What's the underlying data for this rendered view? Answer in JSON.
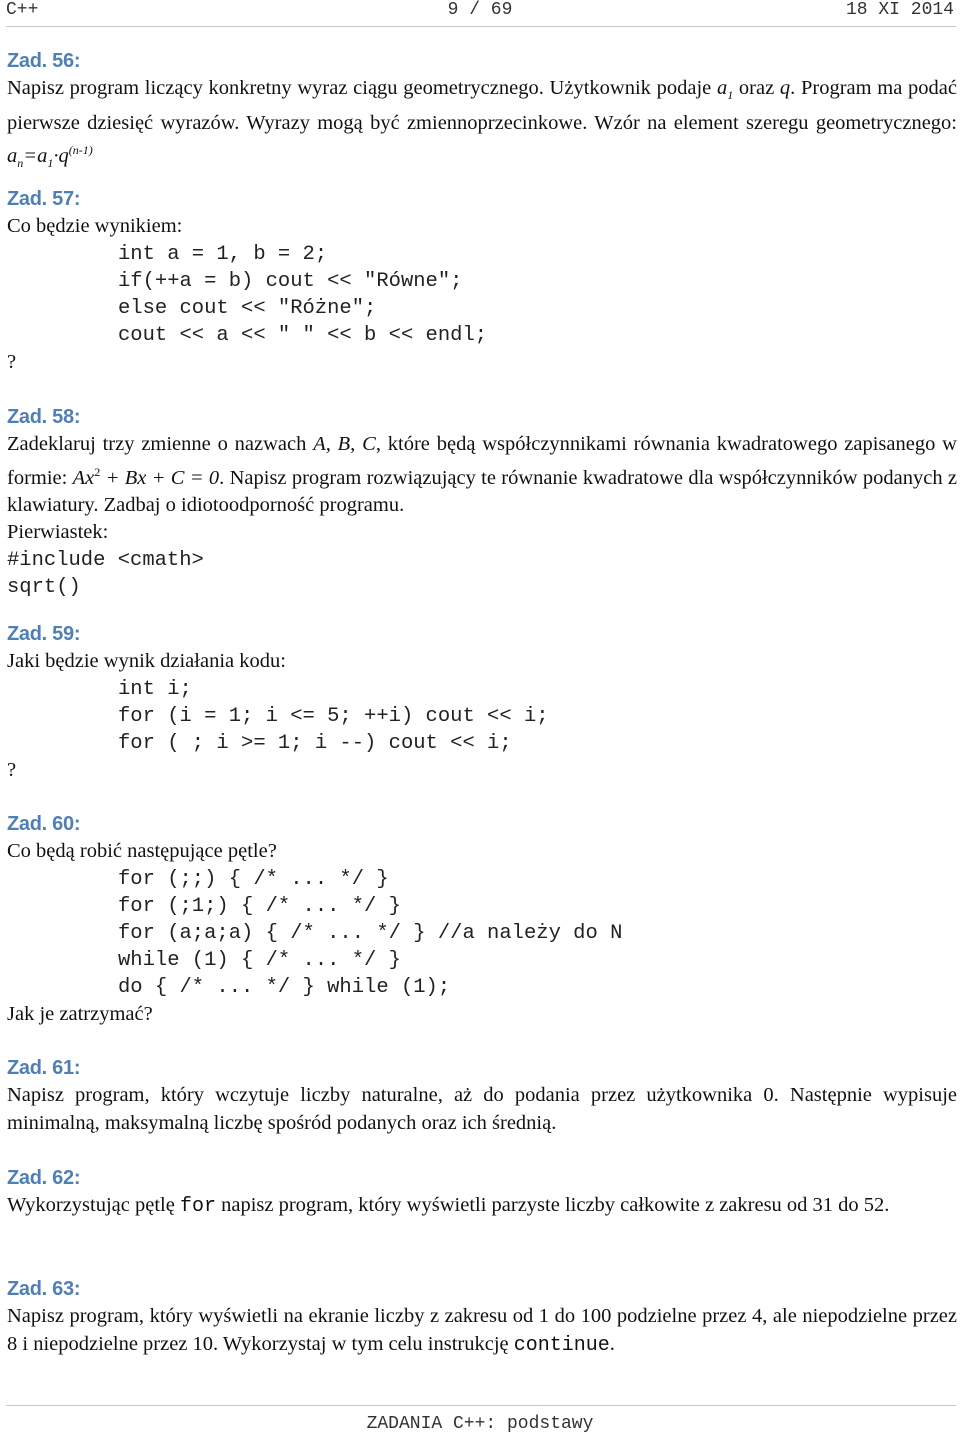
{
  "header": {
    "left": "C++",
    "page": "9 / 69",
    "date": "18 XI 2014"
  },
  "footer": "ZADANIA C++: podstawy",
  "tasks": {
    "z56": {
      "title": "Zad. 56:",
      "t1": "Napisz program liczący konkretny wyraz ciągu geometrycznego. Użytkownik podaje ",
      "a": "a",
      "a_sub": "1",
      "t2": " oraz ",
      "q": "q",
      "t3": ". Program ma podać pierwsze dziesięć wyrazów. Wyrazy mogą być zmiennoprzecinkowe. Wzór na element szeregu geometrycznego: ",
      "f_an": "a",
      "f_n": "n",
      "f_eq": "=a",
      "f_1": "1",
      "f_dot": "·q",
      "f_exp": "(n-1)"
    },
    "z57": {
      "title": "Zad. 57:",
      "intro": "Co będzie wynikiem:",
      "code": [
        "int a = 1, b = 2;",
        "if(++a = b) cout << \"Równe\";",
        "else cout << \"Różne\";",
        "cout << a << \" \" << b << endl;"
      ],
      "question": "?"
    },
    "z58": {
      "title": "Zad. 58:",
      "t1": "Zadeklaruj trzy zmienne o nazwach ",
      "vars": "A, B, C",
      "t2": ", które będą współczynnikami równania kwadratowego zapisanego w formie: ",
      "eq1": "Ax",
      "eq_sup": "2",
      "eq2": " + Bx + C = 0",
      "t3": ". Napisz program rozwiązujący te równanie kwadratowe dla współczynników podanych z klawiatury. Zadbaj o idiotoodporność programu.",
      "hint": "Pierwiastek:",
      "code": [
        "#include <cmath>",
        "sqrt()"
      ]
    },
    "z59": {
      "title": "Zad. 59:",
      "intro": "Jaki będzie wynik działania kodu:",
      "code": [
        "int i;",
        "for (i = 1; i <= 5; ++i) cout << i;",
        "for ( ; i >= 1; i --) cout << i;"
      ],
      "question": "?"
    },
    "z60": {
      "title": "Zad. 60:",
      "intro": "Co będą robić następujące pętle?",
      "code": [
        "for (;;) { /* ... */ }",
        "for (;1;) { /* ... */ }",
        "for (a;a;a) { /* ... */ } //a należy do N",
        "while (1) { /* ... */ }",
        "do { /* ... */ } while (1);"
      ],
      "outro": "Jak je zatrzymać?"
    },
    "z61": {
      "title": "Zad. 61:",
      "text": "Napisz program, który wczytuje liczby naturalne, aż do podania przez użytkownika 0. Następnie wypisuje minimalną, maksymalną liczbę spośród podanych oraz ich średnią."
    },
    "z62": {
      "title": "Zad. 62:",
      "t1": "Wykorzystując pętlę ",
      "kw": "for",
      "t2": " napisz program, który wyświetli parzyste liczby całkowite z zakresu od 31 do 52."
    },
    "z63": {
      "title": "Zad. 63:",
      "t1": "Napisz program, który wyświetli na ekranie liczby z zakresu od 1 do 100 podzielne przez 4, ale niepodzielne przez 8 i niepodzielne przez 10. Wykorzystaj w tym celu instrukcję ",
      "kw": "continue",
      "t2": "."
    }
  }
}
